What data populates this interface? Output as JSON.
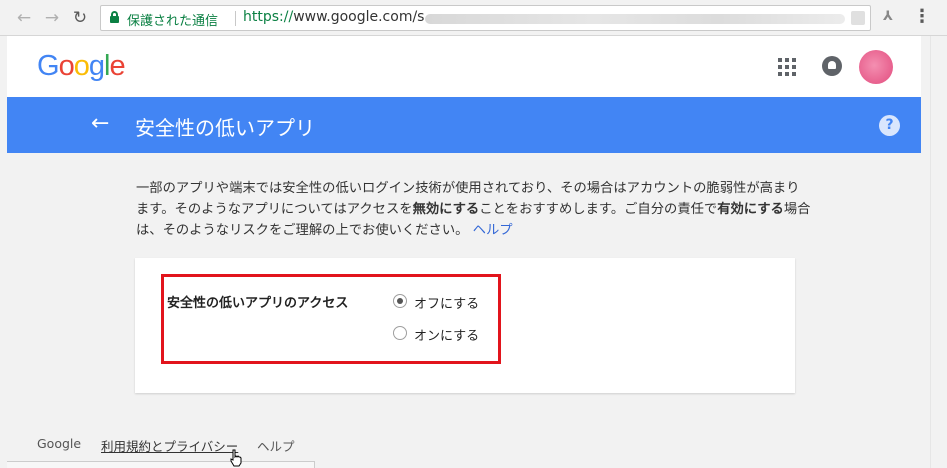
{
  "browser": {
    "back_glyph": "←",
    "forward_glyph": "→",
    "reload_glyph": "↻",
    "secure_label": "保護された通信",
    "url_scheme": "https://",
    "url_host": "www.google.com/s",
    "ext_glyph": "⅄",
    "menu_glyph": "⋮"
  },
  "header": {
    "logo": "Google"
  },
  "title_bar": {
    "back_glyph": "←",
    "title": "安全性の低いアプリ",
    "help_glyph": "?"
  },
  "description": {
    "part1": "一部のアプリや端末では安全性の低いログイン技術が使用されており、その場合はアカウントの脆弱性が高まります。そのようなアプリについてはアクセスを",
    "bold1": "無効にする",
    "part2": "ことをおすすめします。ご自分の責任で",
    "bold2": "有効にする",
    "part3": "場合は、そのようなリスクをご理解の上でお使いください。",
    "help_link": "ヘルプ"
  },
  "setting": {
    "label": "安全性の低いアプリのアクセス",
    "options": [
      {
        "label": "オフにする",
        "selected": true
      },
      {
        "label": "オンにする",
        "selected": false
      }
    ]
  },
  "footer": {
    "google": "Google",
    "terms": "利用規約とプライバシー",
    "help": "ヘルプ"
  },
  "colors": {
    "brand_blue": "#4285f4",
    "highlight_red": "#e2141c",
    "secure_green": "#0b8043"
  }
}
